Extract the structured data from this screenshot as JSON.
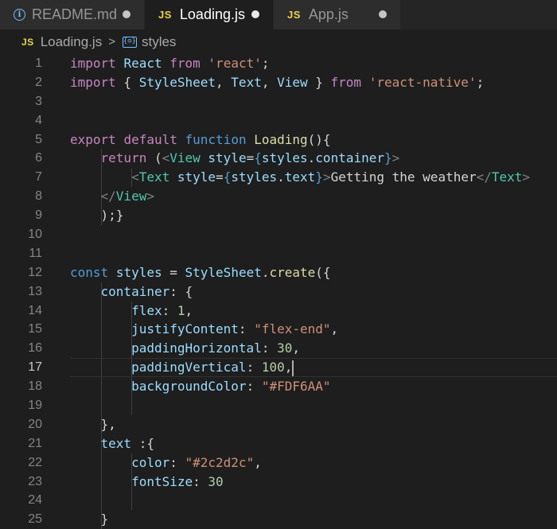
{
  "tabs": [
    {
      "label": "README.md",
      "icon": "info-icon",
      "active": false
    },
    {
      "label": "Loading.js",
      "icon": "js-icon",
      "active": true
    },
    {
      "label": "App.js",
      "icon": "js-icon",
      "active": false
    }
  ],
  "js_badge": "JS",
  "info_glyph": "i",
  "breadcrumb": {
    "file": "Loading.js",
    "separator": ">",
    "symbol": "styles",
    "symbol_glyph": "{⊝}"
  },
  "current_line": 17,
  "colors": {
    "keyword": "#c586c0",
    "string": "#ce9178",
    "variable": "#9cdcfe",
    "type": "#4ec9b0",
    "function": "#dcdcaa",
    "number": "#b5cea8",
    "tag_bracket": "#808080",
    "info_accent": "#75beff",
    "js_accent": "#e8d44d"
  },
  "lines": [
    {
      "n": 1,
      "tokens": [
        [
          "kw",
          "import"
        ],
        [
          "pl",
          " "
        ],
        [
          "vr",
          "React"
        ],
        [
          "pl",
          " "
        ],
        [
          "kw",
          "from"
        ],
        [
          "pl",
          " "
        ],
        [
          "st",
          "'react'"
        ],
        [
          "pl",
          ";"
        ]
      ]
    },
    {
      "n": 2,
      "tokens": [
        [
          "kw",
          "import"
        ],
        [
          "pl",
          " { "
        ],
        [
          "vr",
          "StyleSheet"
        ],
        [
          "pl",
          ", "
        ],
        [
          "vr",
          "Text"
        ],
        [
          "pl",
          ", "
        ],
        [
          "vr",
          "View"
        ],
        [
          "pl",
          " } "
        ],
        [
          "kw",
          "from"
        ],
        [
          "pl",
          " "
        ],
        [
          "st",
          "'react-native'"
        ],
        [
          "pl",
          ";"
        ]
      ]
    },
    {
      "n": 3,
      "tokens": []
    },
    {
      "n": 4,
      "tokens": []
    },
    {
      "n": 5,
      "tokens": [
        [
          "kw",
          "export"
        ],
        [
          "pl",
          " "
        ],
        [
          "kw",
          "default"
        ],
        [
          "pl",
          " "
        ],
        [
          "bl",
          "function"
        ],
        [
          "pl",
          " "
        ],
        [
          "fn",
          "Loading"
        ],
        [
          "pl",
          "(){"
        ]
      ]
    },
    {
      "n": 6,
      "tokens": [
        [
          "pl",
          "    "
        ],
        [
          "kw",
          "return"
        ],
        [
          "pl",
          " ("
        ],
        [
          "gr",
          "<"
        ],
        [
          "ty",
          "View"
        ],
        [
          "pl",
          " "
        ],
        [
          "vr",
          "style"
        ],
        [
          "pl",
          "="
        ],
        [
          "bl",
          "{"
        ],
        [
          "vr",
          "styles"
        ],
        [
          "pl",
          "."
        ],
        [
          "vr",
          "container"
        ],
        [
          "bl",
          "}"
        ],
        [
          "gr",
          ">"
        ]
      ]
    },
    {
      "n": 7,
      "tokens": [
        [
          "pl",
          "        "
        ],
        [
          "gr",
          "<"
        ],
        [
          "ty",
          "Text"
        ],
        [
          "pl",
          " "
        ],
        [
          "vr",
          "style"
        ],
        [
          "pl",
          "="
        ],
        [
          "bl",
          "{"
        ],
        [
          "vr",
          "styles"
        ],
        [
          "pl",
          "."
        ],
        [
          "vr",
          "text"
        ],
        [
          "bl",
          "}"
        ],
        [
          "gr",
          ">"
        ],
        [
          "pl",
          "Getting the weather"
        ],
        [
          "gr",
          "</"
        ],
        [
          "ty",
          "Text"
        ],
        [
          "gr",
          ">"
        ]
      ]
    },
    {
      "n": 8,
      "tokens": [
        [
          "pl",
          "    "
        ],
        [
          "gr",
          "</"
        ],
        [
          "ty",
          "View"
        ],
        [
          "gr",
          ">"
        ]
      ]
    },
    {
      "n": 9,
      "tokens": [
        [
          "pl",
          "    );}"
        ]
      ]
    },
    {
      "n": 10,
      "tokens": []
    },
    {
      "n": 11,
      "tokens": []
    },
    {
      "n": 12,
      "tokens": [
        [
          "bl",
          "const"
        ],
        [
          "pl",
          " "
        ],
        [
          "vr",
          "styles"
        ],
        [
          "pl",
          " = "
        ],
        [
          "vr",
          "StyleSheet"
        ],
        [
          "pl",
          "."
        ],
        [
          "fn",
          "create"
        ],
        [
          "pl",
          "({"
        ]
      ]
    },
    {
      "n": 13,
      "tokens": [
        [
          "pl",
          "    "
        ],
        [
          "vr",
          "container"
        ],
        [
          "pl",
          ": {"
        ]
      ]
    },
    {
      "n": 14,
      "tokens": [
        [
          "pl",
          "        "
        ],
        [
          "vr",
          "flex"
        ],
        [
          "pl",
          ": "
        ],
        [
          "nm",
          "1"
        ],
        [
          "pl",
          ","
        ]
      ]
    },
    {
      "n": 15,
      "tokens": [
        [
          "pl",
          "        "
        ],
        [
          "vr",
          "justifyContent"
        ],
        [
          "pl",
          ": "
        ],
        [
          "st",
          "\"flex-end\""
        ],
        [
          "pl",
          ","
        ]
      ]
    },
    {
      "n": 16,
      "tokens": [
        [
          "pl",
          "        "
        ],
        [
          "vr",
          "paddingHorizontal"
        ],
        [
          "pl",
          ": "
        ],
        [
          "nm",
          "30"
        ],
        [
          "pl",
          ","
        ]
      ]
    },
    {
      "n": 17,
      "tokens": [
        [
          "pl",
          "        "
        ],
        [
          "vr",
          "paddingVertical"
        ],
        [
          "pl",
          ": "
        ],
        [
          "nm",
          "100"
        ],
        [
          "pl",
          ","
        ]
      ]
    },
    {
      "n": 18,
      "tokens": [
        [
          "pl",
          "        "
        ],
        [
          "vr",
          "backgroundColor"
        ],
        [
          "pl",
          ": "
        ],
        [
          "st",
          "\"#FDF6AA\""
        ]
      ]
    },
    {
      "n": 19,
      "tokens": []
    },
    {
      "n": 20,
      "tokens": [
        [
          "pl",
          "    },"
        ]
      ]
    },
    {
      "n": 21,
      "tokens": [
        [
          "pl",
          "    "
        ],
        [
          "vr",
          "text"
        ],
        [
          "pl",
          " :{"
        ]
      ]
    },
    {
      "n": 22,
      "tokens": [
        [
          "pl",
          "        "
        ],
        [
          "vr",
          "color"
        ],
        [
          "pl",
          ": "
        ],
        [
          "st",
          "\"#2c2d2c\""
        ],
        [
          "pl",
          ","
        ]
      ]
    },
    {
      "n": 23,
      "tokens": [
        [
          "pl",
          "        "
        ],
        [
          "vr",
          "fontSize"
        ],
        [
          "pl",
          ": "
        ],
        [
          "nm",
          "30"
        ]
      ]
    },
    {
      "n": 24,
      "tokens": []
    },
    {
      "n": 25,
      "tokens": [
        [
          "pl",
          "    }"
        ]
      ]
    }
  ]
}
